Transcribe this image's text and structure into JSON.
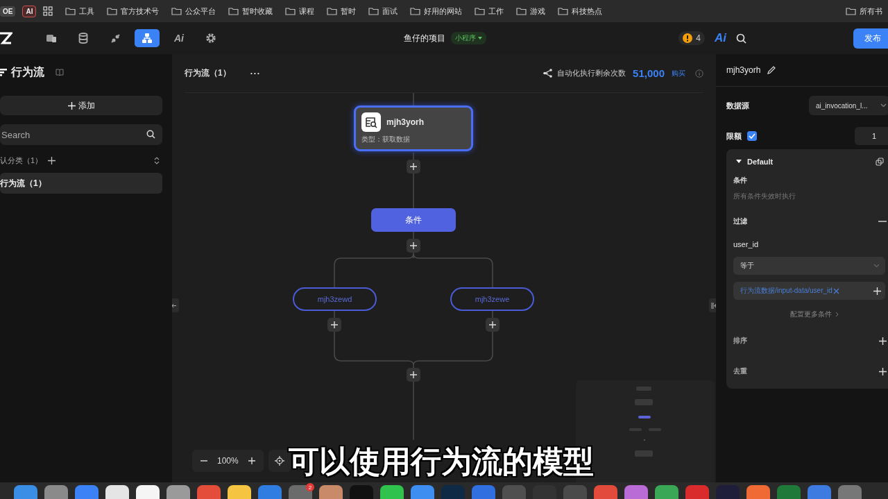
{
  "bookmarks_bar": {
    "badges": [
      {
        "label": "OE",
        "kind": "plain"
      },
      {
        "label": "AI",
        "kind": "outlined"
      }
    ],
    "folders": [
      "工具",
      "官方技术号",
      "公众平台",
      "暂时收藏",
      "课程",
      "暂时",
      "面试",
      "好用的网站",
      "工作",
      "游戏",
      "科技热点"
    ],
    "overflow": "所有书"
  },
  "app_header": {
    "tools": [
      {
        "kind": "pages",
        "selected": false
      },
      {
        "kind": "database",
        "selected": false
      },
      {
        "kind": "plugin",
        "selected": false
      },
      {
        "kind": "flow",
        "selected": true
      },
      {
        "kind": "ai",
        "label": "Ai",
        "selected": false
      },
      {
        "kind": "settings",
        "selected": false
      }
    ],
    "project": "鱼仔的项目",
    "project_tag": "小程序",
    "alerts": "4",
    "ai_label": "Ai",
    "publish": "发布"
  },
  "sidebar": {
    "title": "行为流",
    "add": "添加",
    "search_placeholder": "Search",
    "category": "认分类（1）",
    "items": [
      {
        "label": "行为流（1）",
        "selected": true
      }
    ]
  },
  "canvas": {
    "title": "行为流（1）",
    "more": "···",
    "quota_label": "自动化执行剩余次数",
    "quota": "51,000",
    "buy": "购买",
    "start_node": {
      "title": "mjh3yorh",
      "subtitle": "类型：获取数据",
      "selected": true
    },
    "condition": "条件",
    "branches": [
      "mjh3zewd",
      "mjh3zewe"
    ],
    "zoom": "100%"
  },
  "inspector": {
    "title": "mjh3yorh",
    "source_label": "数据源",
    "source_value": "ai_invocation_l...",
    "limit_label": "限额",
    "limit_checked": true,
    "limit_value": "1",
    "group": {
      "title": "Default",
      "expanded": true,
      "condition_label": "条件",
      "condition_hint": "所有条件失效时执行",
      "filter_label": "过滤",
      "field": "user_id",
      "operator": "等于",
      "value": "行为流数据/input-data/user_id",
      "more": "配置更多条件",
      "sort_label": "排序",
      "dedupe_label": "去重"
    }
  },
  "subtitle": "可以使用行为流的模型",
  "dock": [
    {
      "color": "#3a8ee6"
    },
    {
      "color": "#8a8a8a"
    },
    {
      "color": "#3b82f6"
    },
    {
      "color": "#e5e5e5"
    },
    {
      "color": "#f5f5f5"
    },
    {
      "color": "#9a9a9a"
    },
    {
      "color": "#e44d3a"
    },
    {
      "color": "#f5c542"
    },
    {
      "color": "#2f7de1"
    },
    {
      "color": "#6b6b6b",
      "badge": "2"
    },
    {
      "color": "#c98a6a"
    },
    {
      "color": "#111111"
    },
    {
      "color": "#2fc24d"
    },
    {
      "color": "#3d8ef0"
    },
    {
      "color": "#0f2a44"
    },
    {
      "color": "#2f6fe0"
    },
    {
      "color": "#4f4f4f"
    },
    {
      "color": "#333333"
    },
    {
      "color": "#4a4a4a"
    },
    {
      "color": "#e24a3b"
    },
    {
      "color": "#b96bd6"
    },
    {
      "color": "#3aa757"
    },
    {
      "color": "#d92b2b"
    },
    {
      "color": "#1e1e3a"
    },
    {
      "color": "#f06a35"
    },
    {
      "color": "#1f7a3a"
    },
    {
      "color": "#3d7be0"
    },
    {
      "color": "#777777"
    }
  ]
}
